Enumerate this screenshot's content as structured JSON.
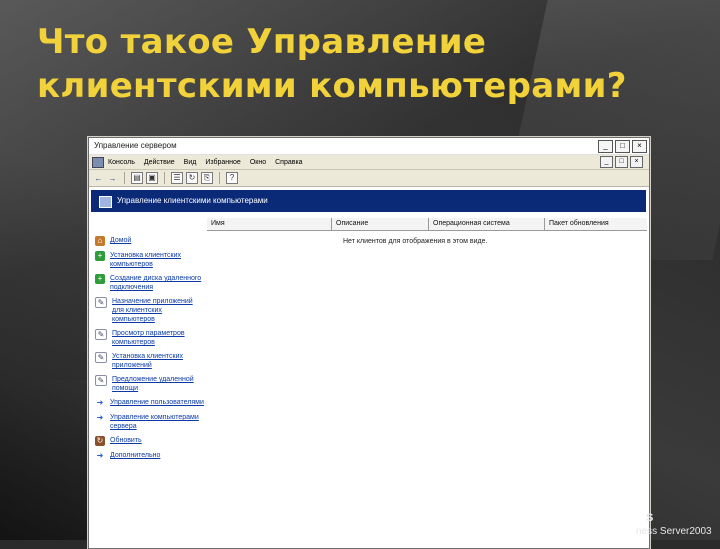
{
  "slide": {
    "title_line1": "Что такое Управление",
    "title_line2": "клиентскими компьютерами?",
    "brand_line1": "S",
    "brand_line2": "ness Server2003"
  },
  "window": {
    "title": "Управление сервером",
    "buttons": [
      "_",
      "□",
      "×"
    ],
    "menu": [
      "Консоль",
      "Действие",
      "Вид",
      "Избранное",
      "Окно",
      "Справка"
    ],
    "mdi_buttons": [
      "_",
      "□",
      "×"
    ],
    "toolbar_icons": [
      "back-arrow-icon",
      "forward-arrow-icon",
      "up-folder-icon",
      "show-hide-tree-icon",
      "properties-icon",
      "refresh-icon",
      "export-icon",
      "help-icon"
    ],
    "console_header": "Управление клиентскими компьютерами",
    "columns": [
      "Имя",
      "Описание",
      "Операционная система",
      "Пакет обновления"
    ],
    "empty_message": "Нет клиентов для отображения в этом виде.",
    "tasks": [
      {
        "icon": "house-icon",
        "label": "Домой"
      },
      {
        "icon": "add-icon",
        "label": "Установка клиентских компьютеров"
      },
      {
        "icon": "add-icon",
        "label": "Создание диска удаленного подключения"
      },
      {
        "icon": "tools-icon",
        "label": "Назначение приложений для клиентских компьютеров"
      },
      {
        "icon": "tools-icon",
        "label": "Просмотр параметров компьютеров"
      },
      {
        "icon": "tools-icon",
        "label": "Установка клиентских приложений"
      },
      {
        "icon": "tools-icon",
        "label": "Предложение удаленной помощи"
      },
      {
        "icon": "arrow-icon",
        "label": "Управление пользователями"
      },
      {
        "icon": "arrow-icon",
        "label": "Управление компьютерами сервера"
      },
      {
        "icon": "refresh-icon",
        "label": "Обновить"
      },
      {
        "icon": "arrow-icon",
        "label": "Дополнительно"
      }
    ]
  },
  "colors": {
    "title": "#f2d23a",
    "console_header_bg": "#0a2a78",
    "link": "#0b3aa8"
  }
}
